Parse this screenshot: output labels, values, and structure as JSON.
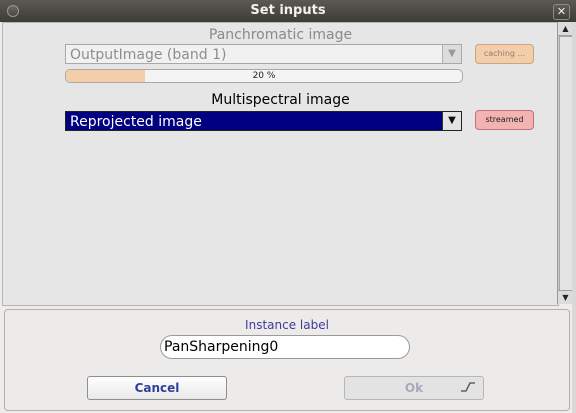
{
  "window": {
    "title": "Set inputs",
    "close_glyph": "✕"
  },
  "panchromatic": {
    "label": "Panchromatic image",
    "selected": "OutputImage (band 1)",
    "progress": {
      "percent": 20,
      "text": "20 %"
    },
    "status": "caching ..."
  },
  "multispectral": {
    "label": "Multispectral image",
    "selected": "Reprojected image",
    "status": "streamed"
  },
  "instance": {
    "label": "Instance label",
    "value": "PanSharpening0"
  },
  "buttons": {
    "cancel": "Cancel",
    "ok": "Ok"
  },
  "icons": {
    "dropdown": "chevron-down-icon",
    "scroll_up": "arrow-up-icon",
    "scroll_down": "arrow-down-icon"
  },
  "colors": {
    "selection": "#000080",
    "caching": "#f4ceaa",
    "streamed": "#f3b3b3",
    "accent_text": "#2f3f99"
  }
}
